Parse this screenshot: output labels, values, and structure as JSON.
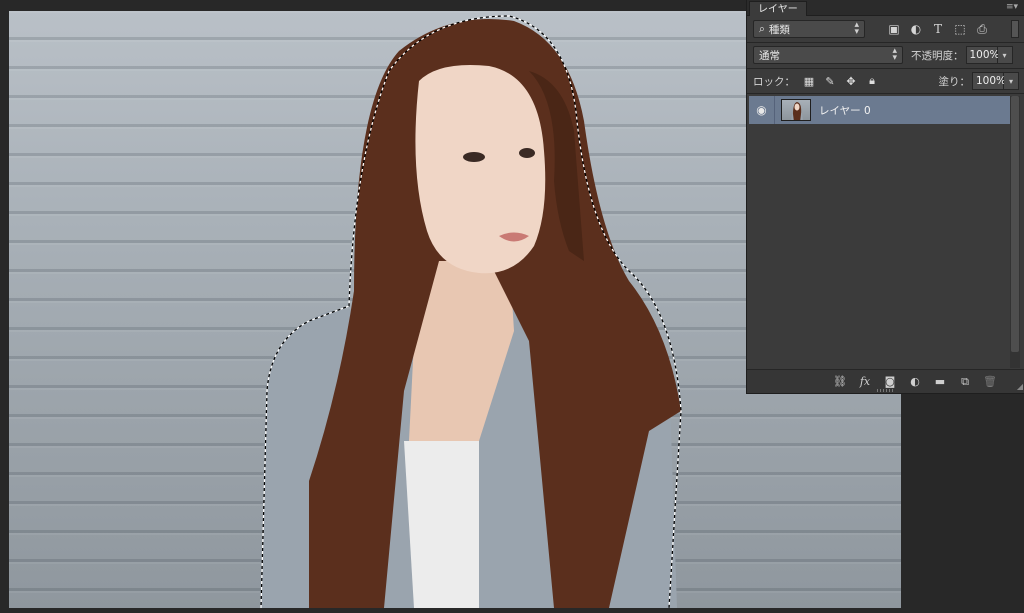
{
  "panel": {
    "tab_label": "レイヤー",
    "menu_icon": "panel-menu-icon",
    "filter": {
      "icon": "search-icon",
      "value": "種類"
    },
    "filter_icons": [
      "image-filter-icon",
      "adjustment-filter-icon",
      "type-filter-icon",
      "shape-filter-icon",
      "smart-object-filter-icon"
    ],
    "blend_mode": "通常",
    "opacity_label": "不透明度：",
    "opacity_value": "100%",
    "lock_label": "ロック：",
    "lock_icons": [
      "lock-transparency-icon",
      "lock-pixels-icon",
      "lock-position-icon",
      "lock-all-icon"
    ],
    "fill_label": "塗り：",
    "fill_value": "100%",
    "layers": [
      {
        "name": "レイヤー 0",
        "visible": true,
        "selected": true
      }
    ],
    "bottom_icons": [
      "link-icon",
      "fx-icon",
      "mask-icon",
      "adjustment-layer-icon",
      "folder-icon",
      "new-layer-icon",
      "trash-icon"
    ],
    "fx_label": "fx"
  },
  "colors": {
    "selected_layer": "#6b7a90",
    "panel_bg": "#3b3b3b",
    "app_bg": "#282828"
  }
}
